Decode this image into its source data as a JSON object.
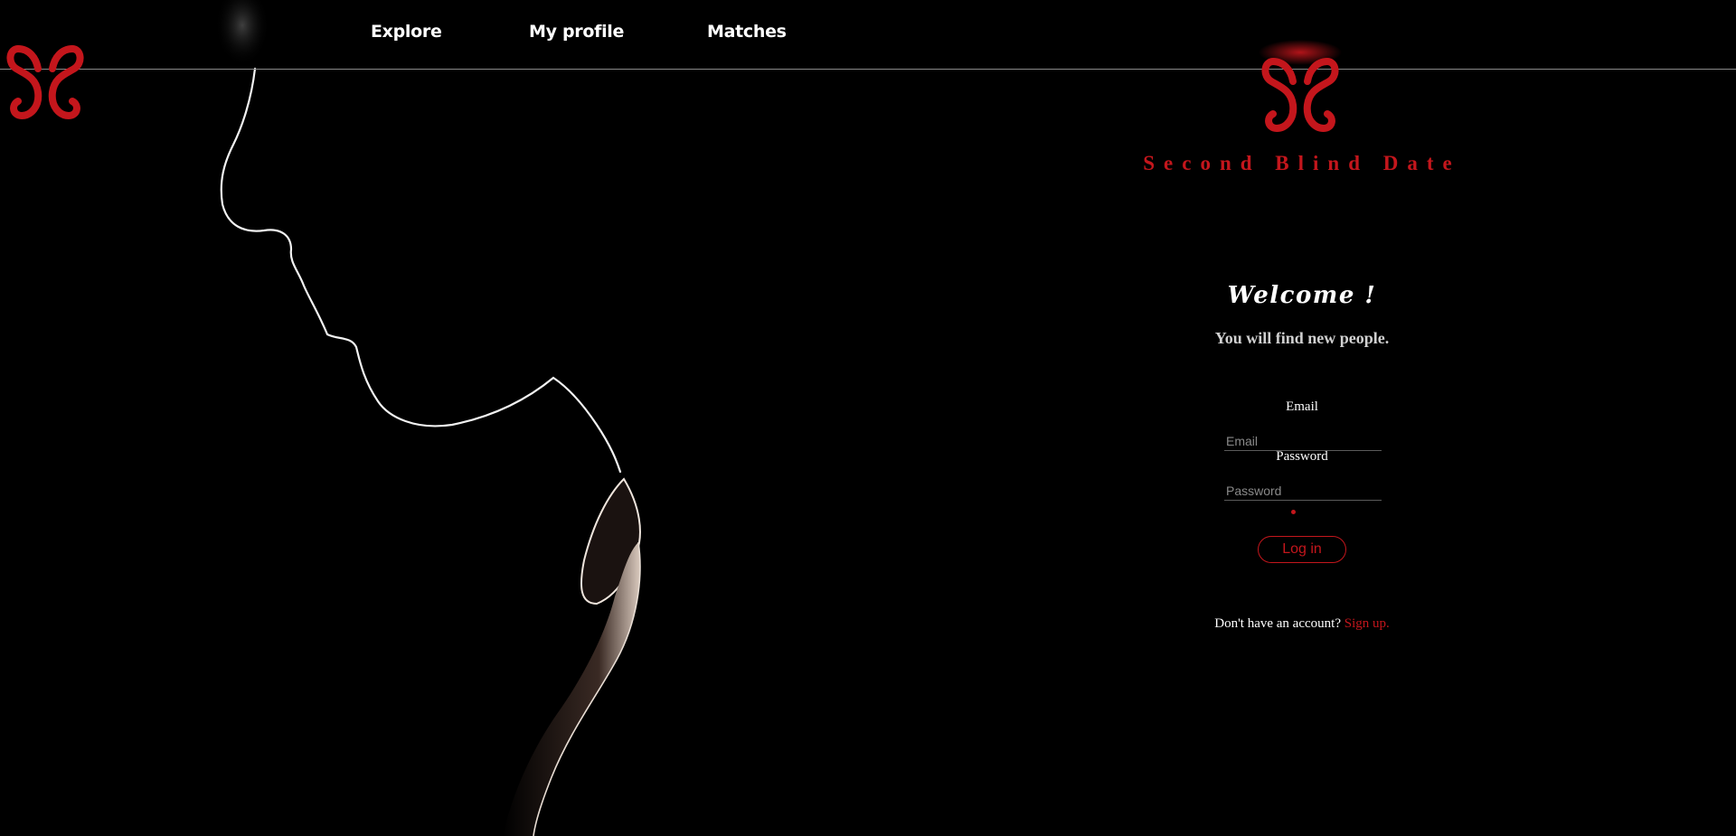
{
  "nav": {
    "items": [
      {
        "label": "Explore"
      },
      {
        "label": "My profile"
      },
      {
        "label": "Matches"
      }
    ]
  },
  "brand": {
    "name": "Second Blind Date",
    "logo_icon": "double-s-heart-logo"
  },
  "login": {
    "welcome": "Welcome !",
    "subtitle": "You will find new people.",
    "email_label": "Email",
    "email_placeholder": "Email",
    "email_value": "",
    "password_label": "Password",
    "password_placeholder": "Password",
    "password_value": "",
    "button_label": "Log in",
    "signup_prompt": "Don't have an account?",
    "signup_link": "Sign up."
  },
  "colors": {
    "accent": "#c4161c",
    "background": "#000000",
    "text": "#ffffff"
  }
}
